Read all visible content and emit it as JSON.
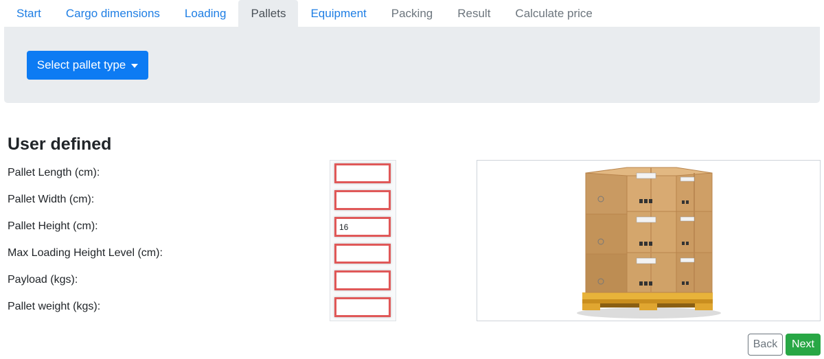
{
  "tabs": [
    {
      "label": "Start",
      "state": "link"
    },
    {
      "label": "Cargo dimensions",
      "state": "link"
    },
    {
      "label": "Loading",
      "state": "link"
    },
    {
      "label": "Pallets",
      "state": "active"
    },
    {
      "label": "Equipment",
      "state": "link"
    },
    {
      "label": "Packing",
      "state": "disabled"
    },
    {
      "label": "Result",
      "state": "disabled"
    },
    {
      "label": "Calculate price",
      "state": "disabled"
    }
  ],
  "pallet_select": {
    "label": "Select pallet type"
  },
  "section": {
    "title": "User defined"
  },
  "fields": [
    {
      "label": "Pallet Length (cm):",
      "value": ""
    },
    {
      "label": "Pallet Width (cm):",
      "value": ""
    },
    {
      "label": "Pallet Height (cm):",
      "value": "16"
    },
    {
      "label": "Max Loading Height Level (cm):",
      "value": ""
    },
    {
      "label": "Payload (kgs):",
      "value": ""
    },
    {
      "label": "Pallet weight (kgs):",
      "value": ""
    }
  ],
  "buttons": {
    "back": "Back",
    "next": "Next"
  },
  "colors": {
    "primary": "#0d7bf3",
    "tab_link": "#1e7ee4",
    "success": "#28a745",
    "input_highlight": "#e05858",
    "panel_bg": "#e9ecef"
  },
  "icons": {
    "dropdown": "caret-down-icon",
    "illustration": "pallet-boxes-image"
  }
}
